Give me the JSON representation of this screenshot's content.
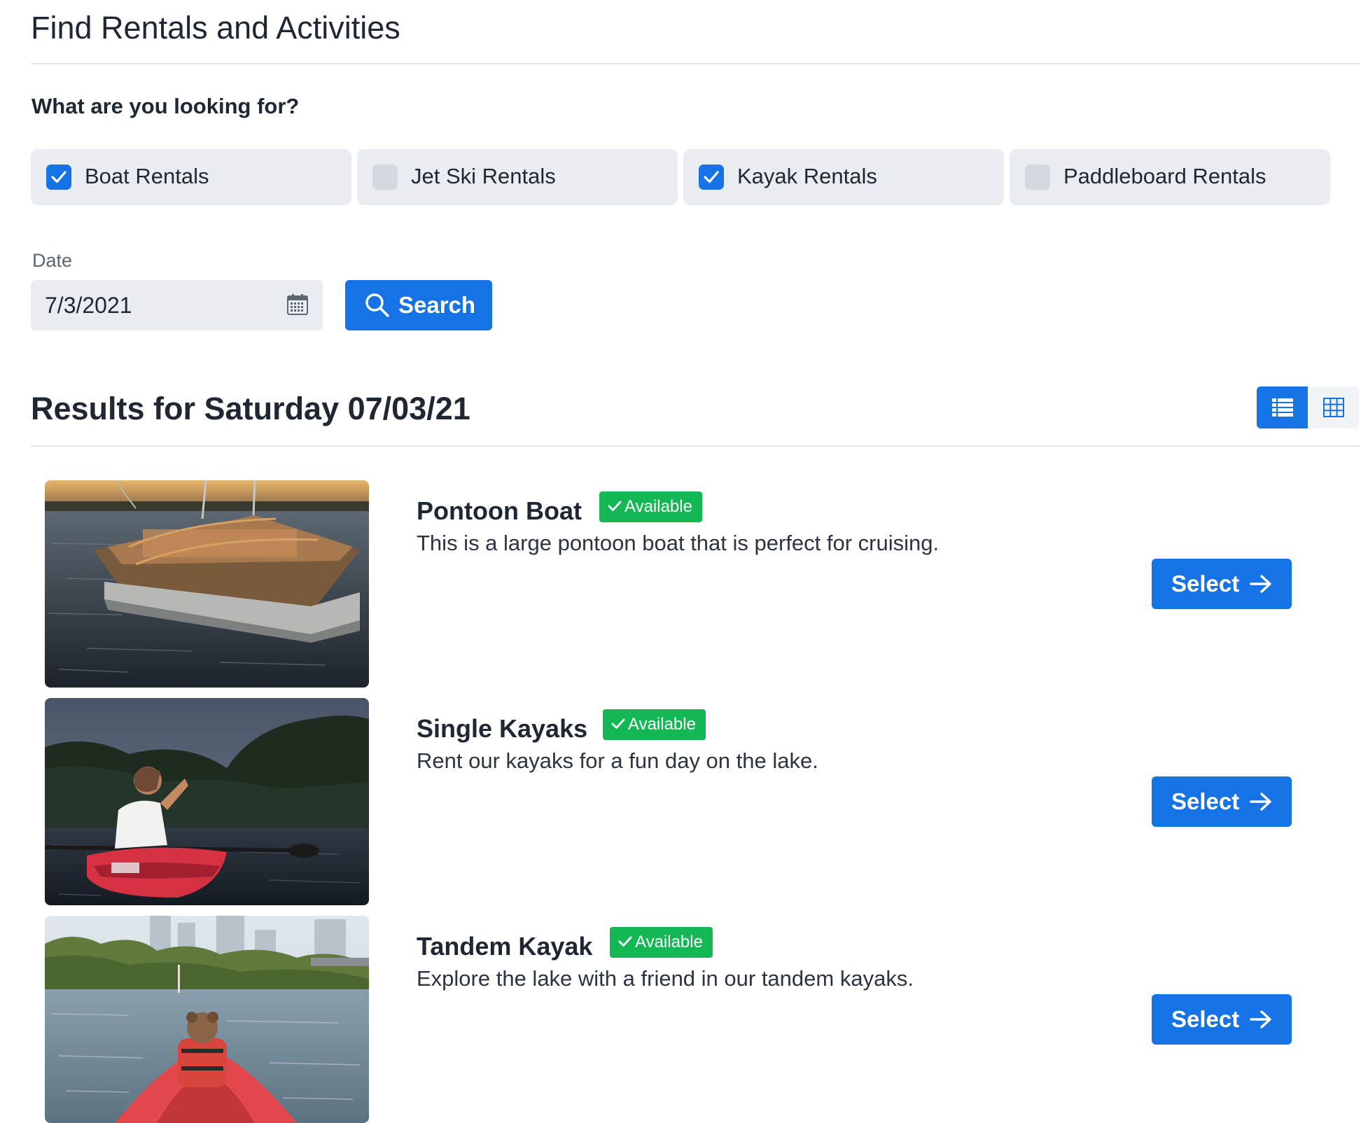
{
  "header": {
    "title": "Find Rentals and Activities"
  },
  "filters": {
    "question": "What are you looking for?",
    "categories": [
      {
        "label": "Boat Rentals",
        "checked": true
      },
      {
        "label": "Jet Ski Rentals",
        "checked": false
      },
      {
        "label": "Kayak Rentals",
        "checked": true
      },
      {
        "label": "Paddleboard Rentals",
        "checked": false
      }
    ],
    "date_label": "Date",
    "date_value": "7/3/2021",
    "search_label": "Search"
  },
  "results": {
    "title": "Results for Saturday 07/03/21",
    "view_mode": "list",
    "items": [
      {
        "name": "Pontoon Boat",
        "status": "Available",
        "description": "This is a large pontoon boat that is perfect for cruising.",
        "action_label": "Select"
      },
      {
        "name": "Single Kayaks",
        "status": "Available",
        "description": "Rent our kayaks for a fun day on the lake.",
        "action_label": "Select"
      },
      {
        "name": "Tandem Kayak",
        "status": "Available",
        "description": "Explore the lake with a friend in our tandem kayaks.",
        "action_label": "Select"
      }
    ]
  },
  "colors": {
    "primary": "#1673e6",
    "success": "#13b754",
    "checkbox_bg": "#e9ecf0"
  },
  "icons": {
    "checkbox": "check-icon",
    "date": "calendar-icon",
    "search": "search-icon",
    "list_view": "list-view-icon",
    "grid_view": "grid-view-icon",
    "badge": "check-icon",
    "select": "arrow-right-icon"
  }
}
